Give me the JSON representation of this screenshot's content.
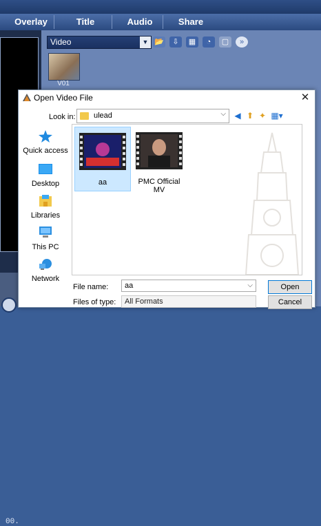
{
  "app": {
    "tabs": [
      "Overlay",
      "Title",
      "Audio",
      "Share"
    ],
    "library_category": "Video",
    "thumbnail_label": "V01",
    "timecode_fragment": "00."
  },
  "dialog": {
    "title": "Open Video File",
    "close_glyph": "✕",
    "look_in_label": "Look in:",
    "look_in_value": "ulead",
    "places": [
      {
        "label": "Quick access",
        "icon": "quick-access-star-icon"
      },
      {
        "label": "Desktop",
        "icon": "desktop-icon"
      },
      {
        "label": "Libraries",
        "icon": "libraries-icon"
      },
      {
        "label": "This PC",
        "icon": "computer-icon"
      },
      {
        "label": "Network",
        "icon": "network-icon"
      }
    ],
    "files": [
      {
        "name": "aa",
        "selected": true
      },
      {
        "name": "PMC Official MV",
        "selected": false
      }
    ],
    "file_name_label": "File name:",
    "file_name_value": "aa",
    "file_type_label": "Files of type:",
    "file_type_value": "All Formats",
    "open_label": "Open",
    "cancel_label": "Cancel",
    "colors": {
      "accent": "#0078d7",
      "selection": "#cce8ff"
    }
  }
}
